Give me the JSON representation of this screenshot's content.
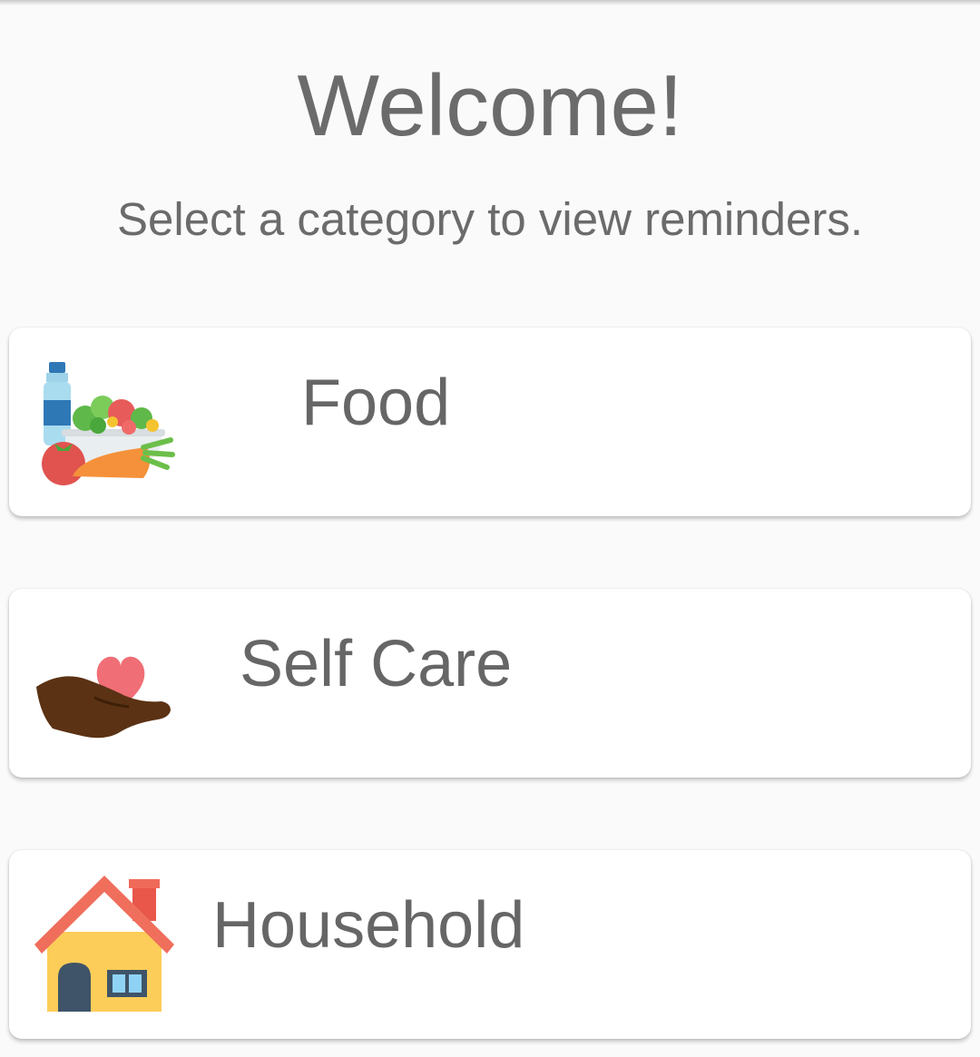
{
  "header": {
    "title": "Welcome!",
    "subtitle": "Select a category to view reminders."
  },
  "categories": [
    {
      "label": "Food",
      "icon": "food-icon"
    },
    {
      "label": "Self Care",
      "icon": "heart-hand-icon"
    },
    {
      "label": "Household",
      "icon": "house-icon"
    }
  ],
  "colors": {
    "background": "#fafafa",
    "card": "#ffffff",
    "text": "#6b6b6b"
  }
}
